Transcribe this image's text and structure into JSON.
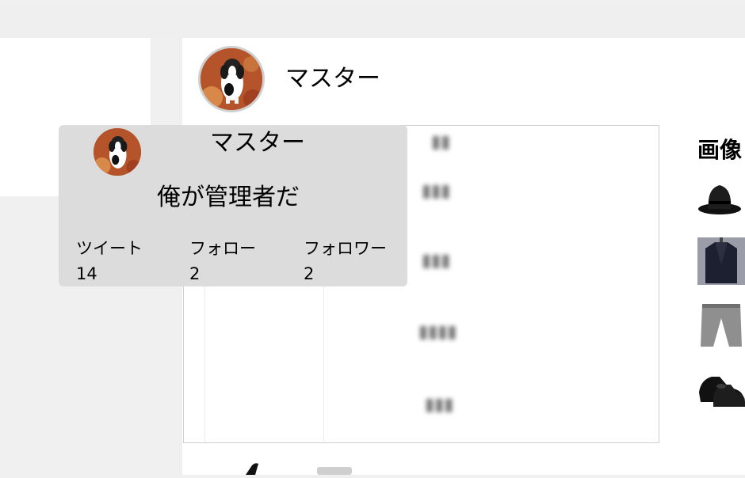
{
  "header": {
    "name": "マスター"
  },
  "popup": {
    "name": "マスター",
    "bio": "俺が管理者だ",
    "stats": [
      {
        "label": "ツイート",
        "value": "14"
      },
      {
        "label": "フォロー",
        "value": "2"
      },
      {
        "label": "フォロワー",
        "value": "2"
      }
    ]
  },
  "sidebar": {
    "title": "画像"
  },
  "icons": {
    "avatar": "dog-avatar-icon",
    "hat": "hat-icon",
    "jacket": "jacket-icon",
    "pants": "pants-icon",
    "shoes": "shoes-icon"
  }
}
